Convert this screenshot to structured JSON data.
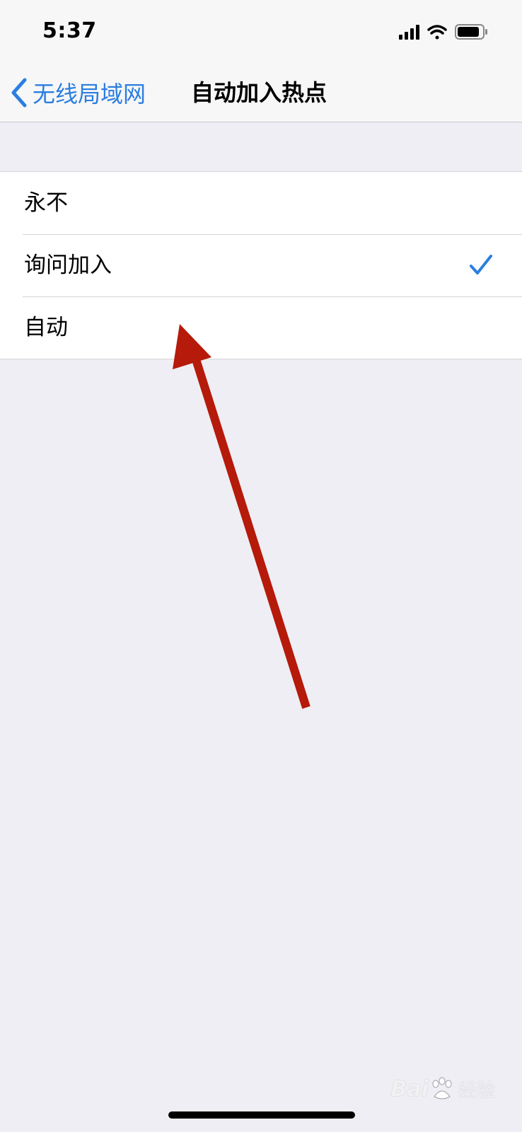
{
  "status_bar": {
    "time": "5:37",
    "icons": [
      "signal-icon",
      "wifi-icon",
      "battery-icon"
    ]
  },
  "nav": {
    "back_label": "无线局域网",
    "title": "自动加入热点",
    "accent_color": "#2b7ee0"
  },
  "options": [
    {
      "label": "永不",
      "selected": false
    },
    {
      "label": "询问加入",
      "selected": true
    },
    {
      "label": "自动",
      "selected": false
    }
  ],
  "annotation": {
    "icon": "red-arrow-annotation",
    "color": "#b51a0a"
  },
  "watermark": {
    "brand": "Bai",
    "suffix": "经验",
    "icon": "baidu-paw-icon"
  }
}
